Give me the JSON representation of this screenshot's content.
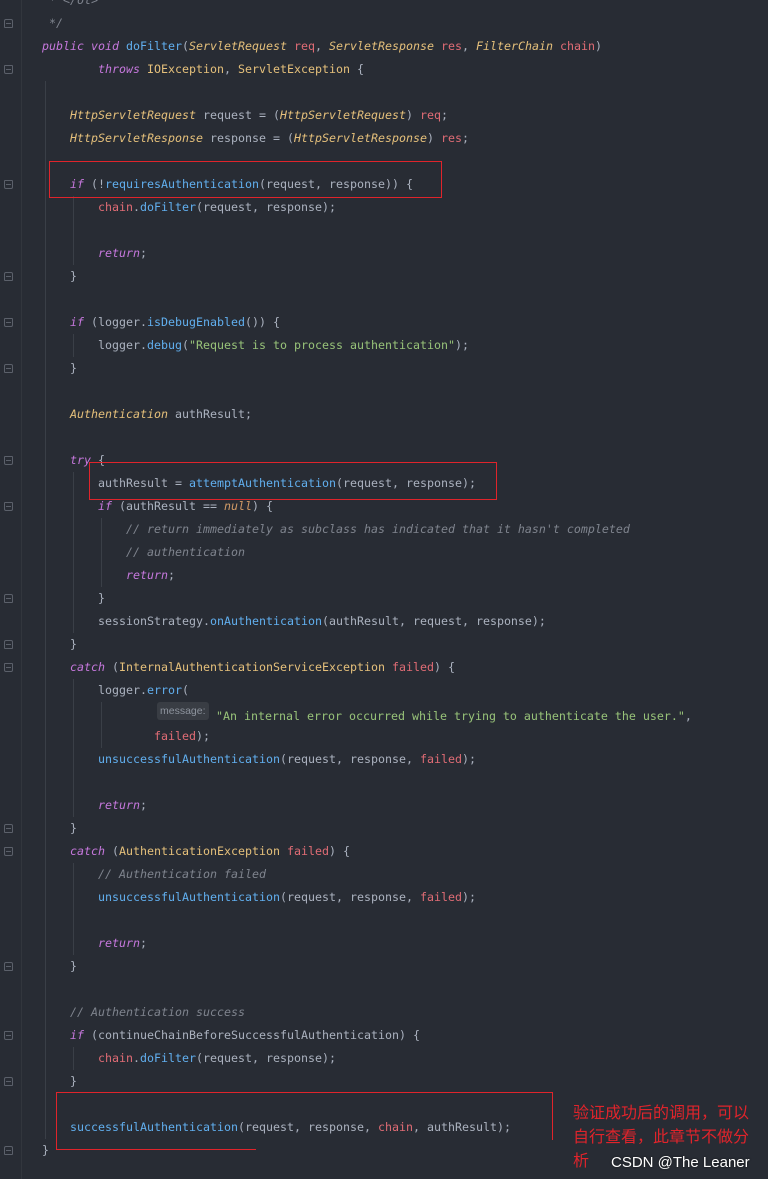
{
  "theme": {
    "background": "#282c34",
    "plain": "#abb2bf",
    "keyword": "#c678dd",
    "method": "#61afef",
    "type": "#e5c07b",
    "param": "#e06c75",
    "const": "#d19a66",
    "string": "#98c379",
    "comment": "#7f848e",
    "annotation": "#e0242b"
  },
  "editor": {
    "lines": [
      {
        "tokens": [
          {
            "t": "comment",
            "s": " * </ol>"
          }
        ]
      },
      {
        "fold": "fold-end-icon",
        "tokens": [
          {
            "t": "comment",
            "s": " */"
          }
        ]
      },
      {
        "tokens": [
          {
            "t": "keyword",
            "s": "public"
          },
          {
            "t": "plain",
            "s": " "
          },
          {
            "t": "keyword",
            "s": "void"
          },
          {
            "t": "plain",
            "s": " "
          },
          {
            "t": "method",
            "s": "doFilter"
          },
          {
            "t": "plain",
            "s": "("
          },
          {
            "t": "itype",
            "s": "ServletRequest"
          },
          {
            "t": "plain",
            "s": " "
          },
          {
            "t": "param",
            "s": "req"
          },
          {
            "t": "plain",
            "s": ", "
          },
          {
            "t": "itype",
            "s": "ServletResponse"
          },
          {
            "t": "plain",
            "s": " "
          },
          {
            "t": "param",
            "s": "res"
          },
          {
            "t": "plain",
            "s": ", "
          },
          {
            "t": "itype",
            "s": "FilterChain"
          },
          {
            "t": "plain",
            "s": " "
          },
          {
            "t": "param",
            "s": "chain"
          },
          {
            "t": "plain",
            "s": ")"
          }
        ]
      },
      {
        "fold": "fold-start-icon",
        "tokens": [
          {
            "t": "plain",
            "s": "        "
          },
          {
            "t": "keyword",
            "s": "throws"
          },
          {
            "t": "plain",
            "s": " "
          },
          {
            "t": "type",
            "s": "IOException"
          },
          {
            "t": "plain",
            "s": ", "
          },
          {
            "t": "type",
            "s": "ServletException"
          },
          {
            "t": "plain",
            "s": " {"
          }
        ]
      },
      {
        "tokens": []
      },
      {
        "tokens": [
          {
            "t": "plain",
            "s": "    "
          },
          {
            "t": "itype",
            "s": "HttpServletRequest"
          },
          {
            "t": "plain",
            "s": " request = ("
          },
          {
            "t": "itype",
            "s": "HttpServletRequest"
          },
          {
            "t": "plain",
            "s": ") "
          },
          {
            "t": "param",
            "s": "req"
          },
          {
            "t": "plain",
            "s": ";"
          }
        ]
      },
      {
        "tokens": [
          {
            "t": "plain",
            "s": "    "
          },
          {
            "t": "itype",
            "s": "HttpServletResponse"
          },
          {
            "t": "plain",
            "s": " response = ("
          },
          {
            "t": "itype",
            "s": "HttpServletResponse"
          },
          {
            "t": "plain",
            "s": ") "
          },
          {
            "t": "param",
            "s": "res"
          },
          {
            "t": "plain",
            "s": ";"
          }
        ]
      },
      {
        "tokens": []
      },
      {
        "fold": "fold-start-icon",
        "tokens": [
          {
            "t": "plain",
            "s": "    "
          },
          {
            "t": "keyword",
            "s": "if"
          },
          {
            "t": "plain",
            "s": " (!"
          },
          {
            "t": "method",
            "s": "requiresAuthentication"
          },
          {
            "t": "plain",
            "s": "(request, response)) {"
          }
        ]
      },
      {
        "tokens": [
          {
            "t": "plain",
            "s": "        "
          },
          {
            "t": "param",
            "s": "chain"
          },
          {
            "t": "plain",
            "s": "."
          },
          {
            "t": "method",
            "s": "doFilter"
          },
          {
            "t": "plain",
            "s": "(request, response);"
          }
        ]
      },
      {
        "tokens": []
      },
      {
        "tokens": [
          {
            "t": "plain",
            "s": "        "
          },
          {
            "t": "keyword",
            "s": "return"
          },
          {
            "t": "plain",
            "s": ";"
          }
        ]
      },
      {
        "fold": "fold-end-icon",
        "tokens": [
          {
            "t": "plain",
            "s": "    }"
          }
        ]
      },
      {
        "tokens": []
      },
      {
        "fold": "fold-start-icon",
        "tokens": [
          {
            "t": "plain",
            "s": "    "
          },
          {
            "t": "keyword",
            "s": "if"
          },
          {
            "t": "plain",
            "s": " (logger."
          },
          {
            "t": "method",
            "s": "isDebugEnabled"
          },
          {
            "t": "plain",
            "s": "()) {"
          }
        ]
      },
      {
        "tokens": [
          {
            "t": "plain",
            "s": "        logger."
          },
          {
            "t": "method",
            "s": "debug"
          },
          {
            "t": "plain",
            "s": "("
          },
          {
            "t": "string",
            "s": "\"Request is to process authentication\""
          },
          {
            "t": "plain",
            "s": ");"
          }
        ]
      },
      {
        "fold": "fold-end-icon",
        "tokens": [
          {
            "t": "plain",
            "s": "    }"
          }
        ]
      },
      {
        "tokens": []
      },
      {
        "tokens": [
          {
            "t": "plain",
            "s": "    "
          },
          {
            "t": "itype",
            "s": "Authentication"
          },
          {
            "t": "plain",
            "s": " authResult;"
          }
        ]
      },
      {
        "tokens": []
      },
      {
        "fold": "fold-start-icon",
        "tokens": [
          {
            "t": "plain",
            "s": "    "
          },
          {
            "t": "keyword",
            "s": "try"
          },
          {
            "t": "plain",
            "s": " {"
          }
        ]
      },
      {
        "tokens": [
          {
            "t": "plain",
            "s": "        authResult = "
          },
          {
            "t": "method",
            "s": "attemptAuthentication"
          },
          {
            "t": "plain",
            "s": "(request, response);"
          }
        ]
      },
      {
        "fold": "fold-start-icon",
        "tokens": [
          {
            "t": "plain",
            "s": "        "
          },
          {
            "t": "keyword",
            "s": "if"
          },
          {
            "t": "plain",
            "s": " (authResult == "
          },
          {
            "t": "const",
            "s": "null"
          },
          {
            "t": "plain",
            "s": ") {"
          }
        ]
      },
      {
        "tokens": [
          {
            "t": "plain",
            "s": "            "
          },
          {
            "t": "comment",
            "s": "// return immediately as subclass has indicated that it hasn't completed"
          }
        ]
      },
      {
        "tokens": [
          {
            "t": "plain",
            "s": "            "
          },
          {
            "t": "comment",
            "s": "// authentication"
          }
        ]
      },
      {
        "tokens": [
          {
            "t": "plain",
            "s": "            "
          },
          {
            "t": "keyword",
            "s": "return"
          },
          {
            "t": "plain",
            "s": ";"
          }
        ]
      },
      {
        "fold": "fold-end-icon",
        "tokens": [
          {
            "t": "plain",
            "s": "        }"
          }
        ]
      },
      {
        "tokens": [
          {
            "t": "plain",
            "s": "        sessionStrategy."
          },
          {
            "t": "method",
            "s": "onAuthentication"
          },
          {
            "t": "plain",
            "s": "(authResult, request, response);"
          }
        ]
      },
      {
        "fold": "fold-end-icon",
        "tokens": [
          {
            "t": "plain",
            "s": "    }"
          }
        ]
      },
      {
        "fold": "fold-start-icon",
        "tokens": [
          {
            "t": "plain",
            "s": "    "
          },
          {
            "t": "keyword",
            "s": "catch"
          },
          {
            "t": "plain",
            "s": " ("
          },
          {
            "t": "type",
            "s": "InternalAuthenticationServiceException"
          },
          {
            "t": "plain",
            "s": " "
          },
          {
            "t": "param",
            "s": "failed"
          },
          {
            "t": "plain",
            "s": ") {"
          }
        ]
      },
      {
        "tokens": [
          {
            "t": "plain",
            "s": "        logger."
          },
          {
            "t": "method",
            "s": "error"
          },
          {
            "t": "plain",
            "s": "("
          }
        ]
      },
      {
        "tokens": [
          {
            "t": "plain",
            "s": "                "
          },
          {
            "t": "hint",
            "s": "message:"
          },
          {
            "t": "string",
            "s": "\"An internal error occurred while trying to authenticate the user.\""
          },
          {
            "t": "plain",
            "s": ","
          }
        ]
      },
      {
        "tokens": [
          {
            "t": "plain",
            "s": "                "
          },
          {
            "t": "param",
            "s": "failed"
          },
          {
            "t": "plain",
            "s": ");"
          }
        ]
      },
      {
        "tokens": [
          {
            "t": "plain",
            "s": "        "
          },
          {
            "t": "method",
            "s": "unsuccessfulAuthentication"
          },
          {
            "t": "plain",
            "s": "(request, response, "
          },
          {
            "t": "param",
            "s": "failed"
          },
          {
            "t": "plain",
            "s": ");"
          }
        ]
      },
      {
        "tokens": []
      },
      {
        "tokens": [
          {
            "t": "plain",
            "s": "        "
          },
          {
            "t": "keyword",
            "s": "return"
          },
          {
            "t": "plain",
            "s": ";"
          }
        ]
      },
      {
        "fold": "fold-end-icon",
        "tokens": [
          {
            "t": "plain",
            "s": "    }"
          }
        ]
      },
      {
        "fold": "fold-start-icon",
        "tokens": [
          {
            "t": "plain",
            "s": "    "
          },
          {
            "t": "keyword",
            "s": "catch"
          },
          {
            "t": "plain",
            "s": " ("
          },
          {
            "t": "type",
            "s": "AuthenticationException"
          },
          {
            "t": "plain",
            "s": " "
          },
          {
            "t": "param",
            "s": "failed"
          },
          {
            "t": "plain",
            "s": ") {"
          }
        ]
      },
      {
        "tokens": [
          {
            "t": "plain",
            "s": "        "
          },
          {
            "t": "comment",
            "s": "// Authentication failed"
          }
        ]
      },
      {
        "tokens": [
          {
            "t": "plain",
            "s": "        "
          },
          {
            "t": "method",
            "s": "unsuccessfulAuthentication"
          },
          {
            "t": "plain",
            "s": "(request, response, "
          },
          {
            "t": "param",
            "s": "failed"
          },
          {
            "t": "plain",
            "s": ");"
          }
        ]
      },
      {
        "tokens": []
      },
      {
        "tokens": [
          {
            "t": "plain",
            "s": "        "
          },
          {
            "t": "keyword",
            "s": "return"
          },
          {
            "t": "plain",
            "s": ";"
          }
        ]
      },
      {
        "fold": "fold-end-icon",
        "tokens": [
          {
            "t": "plain",
            "s": "    }"
          }
        ]
      },
      {
        "tokens": []
      },
      {
        "tokens": [
          {
            "t": "plain",
            "s": "    "
          },
          {
            "t": "comment",
            "s": "// Authentication success"
          }
        ]
      },
      {
        "fold": "fold-start-icon",
        "tokens": [
          {
            "t": "plain",
            "s": "    "
          },
          {
            "t": "keyword",
            "s": "if"
          },
          {
            "t": "plain",
            "s": " (continueChainBeforeSuccessfulAuthentication) {"
          }
        ]
      },
      {
        "tokens": [
          {
            "t": "plain",
            "s": "        "
          },
          {
            "t": "param",
            "s": "chain"
          },
          {
            "t": "plain",
            "s": "."
          },
          {
            "t": "method",
            "s": "doFilter"
          },
          {
            "t": "plain",
            "s": "(request, response);"
          }
        ]
      },
      {
        "fold": "fold-end-icon",
        "tokens": [
          {
            "t": "plain",
            "s": "    }"
          }
        ]
      },
      {
        "tokens": []
      },
      {
        "tokens": [
          {
            "t": "plain",
            "s": "    "
          },
          {
            "t": "method",
            "s": "successfulAuthentication"
          },
          {
            "t": "plain",
            "s": "(request, response, "
          },
          {
            "t": "param",
            "s": "chain"
          },
          {
            "t": "plain",
            "s": ", authResult);"
          }
        ]
      },
      {
        "fold": "fold-end-icon",
        "tokens": [
          {
            "t": "plain",
            "s": "}"
          }
        ]
      }
    ]
  },
  "annotation": {
    "lines": [
      "验证成功后的调用，可以",
      "自行查看，此章节不做分",
      "析"
    ]
  },
  "watermark": {
    "text": "CSDN @The Leaner"
  }
}
